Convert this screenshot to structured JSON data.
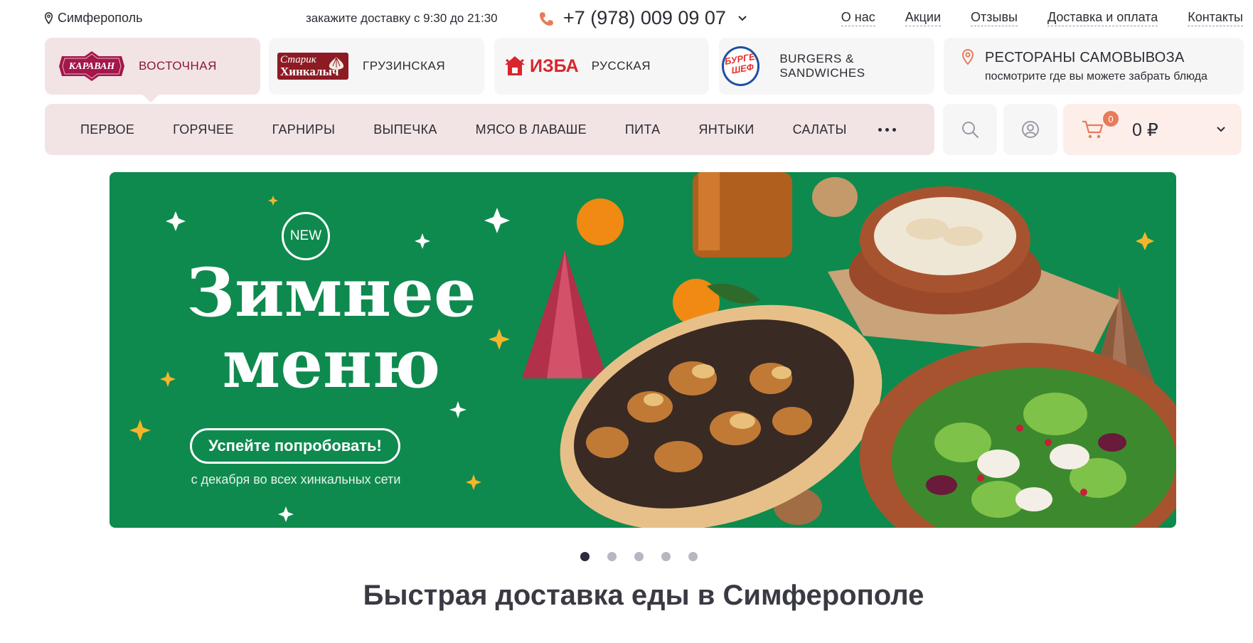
{
  "topbar": {
    "city": "Симферополь",
    "hours": "закажите доставку с 9:30 до 21:30",
    "phone": "+7 (978) 009 09 07",
    "links": [
      "О нас",
      "Акции",
      "Отзывы",
      "Доставка и оплата",
      "Контакты"
    ]
  },
  "brands": [
    {
      "label": "ВОСТОЧНАЯ",
      "logo_text": "КАРАВАН",
      "active": true
    },
    {
      "label": "ГРУЗИНСКАЯ",
      "logo_line1": "Старик",
      "logo_line2": "Хинкалыч"
    },
    {
      "label": "РУССКАЯ",
      "logo_text": "ИЗБА"
    },
    {
      "label": "BURGERS & SANDWICHES",
      "logo_text": "БУРГЕР ШЕФ"
    }
  ],
  "pickup": {
    "title": "РЕСТОРАНЫ САМОВЫВОЗА",
    "subtitle": "посмотрите где вы можете забрать блюда"
  },
  "categories": [
    "ПЕРВОЕ",
    "ГОРЯЧЕЕ",
    "ГАРНИРЫ",
    "ВЫПЕЧКА",
    "МЯСО В ЛАВАШЕ",
    "ПИТА",
    "ЯНТЫКИ",
    "САЛАТЫ"
  ],
  "cart": {
    "count": "0",
    "total": "0 ₽"
  },
  "banner": {
    "badge": "NEW",
    "title_line1": "Зимнее",
    "title_line2": "меню",
    "button": "Успейте попробовать!",
    "subtitle": "с декабря во всех хинкальных сети"
  },
  "slider": {
    "total": 5,
    "active": 1
  },
  "heading": "Быстрая доставка еды в Симферополе",
  "colors": {
    "accent": "#8a1736",
    "active_bg": "#f2e4e5",
    "banner_green": "#0e8a4e",
    "cart_bg": "#fdeeea"
  }
}
